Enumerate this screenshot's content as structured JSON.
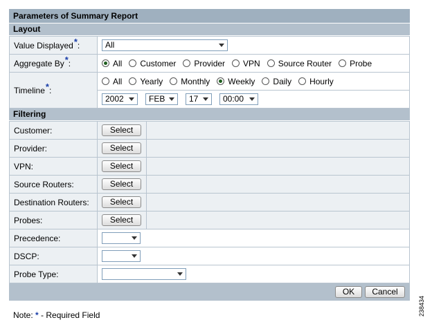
{
  "title": "Parameters of Summary Report",
  "layout": {
    "heading": "Layout",
    "value_displayed": {
      "label": "Value Displayed",
      "selected": "All"
    },
    "aggregate_by": {
      "label": "Aggregate By",
      "options": [
        "All",
        "Customer",
        "Provider",
        "VPN",
        "Source Router",
        "Probe"
      ],
      "selected": "All"
    },
    "timeline": {
      "label": "Timeline",
      "options": [
        "All",
        "Yearly",
        "Monthly",
        "Weekly",
        "Daily",
        "Hourly"
      ],
      "selected": "Weekly",
      "year": "2002",
      "month": "FEB",
      "day": "17",
      "time": "00:00"
    },
    "required_marker": "*"
  },
  "filtering": {
    "heading": "Filtering",
    "select_label": "Select",
    "rows": [
      {
        "label": "Customer:"
      },
      {
        "label": "Provider:"
      },
      {
        "label": "VPN:"
      },
      {
        "label": "Source Routers:"
      },
      {
        "label": "Destination Routers:"
      },
      {
        "label": "Probes:"
      }
    ],
    "precedence": {
      "label": "Precedence:",
      "selected": ""
    },
    "dscp": {
      "label": "DSCP:",
      "selected": ""
    },
    "probe_type": {
      "label": "Probe Type:",
      "selected": ""
    }
  },
  "footer": {
    "ok_label": "OK",
    "cancel_label": "Cancel"
  },
  "note": {
    "prefix": "Note:",
    "star": "*",
    "text": "- Required Field"
  },
  "figure_id": "238434",
  "colors": {
    "title_bar": "#9fb0bf",
    "section_bar": "#b3c0cc",
    "label_bg": "#ecf0f3",
    "required_star": "#1a3ea8"
  }
}
